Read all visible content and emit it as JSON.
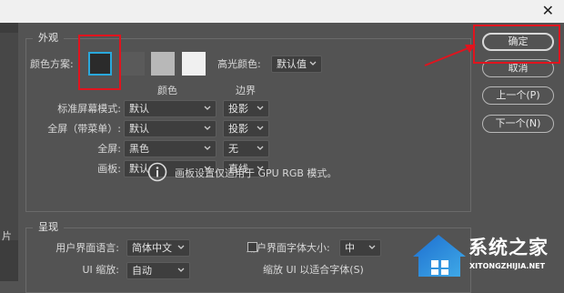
{
  "window": {
    "close_glyph": "✕"
  },
  "sidebar": {
    "partial_label": "片"
  },
  "appearance": {
    "section_title": "外观",
    "color_scheme_label": "颜色方案:",
    "color_schemes": [
      {
        "name": "darkest",
        "color": "#2b2b2b",
        "selected": true,
        "selected_border": "#29a8dc"
      },
      {
        "name": "dark",
        "color": "#535353"
      },
      {
        "name": "light",
        "color": "#b8b8b8"
      },
      {
        "name": "lightest",
        "color": "#f0f0f0"
      }
    ],
    "highlight_label": "高光颜色:",
    "highlight_value": "默认值",
    "columns": {
      "color": "颜色",
      "border": "边界"
    },
    "rows": [
      {
        "label": "标准屏幕模式:",
        "color": "默认",
        "border": "投影"
      },
      {
        "label": "全屏（带菜单）:",
        "color": "默认",
        "border": "投影"
      },
      {
        "label": "全屏:",
        "color": "黑色",
        "border": "无"
      },
      {
        "label": "画板:",
        "color": "默认",
        "border": "直线"
      }
    ],
    "note": "画板设置仅适用于 GPU RGB 模式。"
  },
  "presentation": {
    "section_title": "呈现",
    "ui_language_label": "用户界面语言:",
    "ui_language_value": "简体中文",
    "ui_font_size_label": "用户界面字体大小:",
    "ui_font_size_value": "中",
    "ui_scaling_label": "UI 缩放:",
    "ui_scaling_value": "自动",
    "scale_fonts_label": "缩放 UI 以适合字体(S)",
    "scale_fonts_checked": false
  },
  "buttons": {
    "ok": "确定",
    "cancel": "取消",
    "prev": "上一个(P)",
    "next": "下一个(N)"
  },
  "annotation": {
    "color": "#e0141e"
  },
  "watermark": {
    "main": "系统之家",
    "sub": "XITONGZHIJIA.NET"
  }
}
